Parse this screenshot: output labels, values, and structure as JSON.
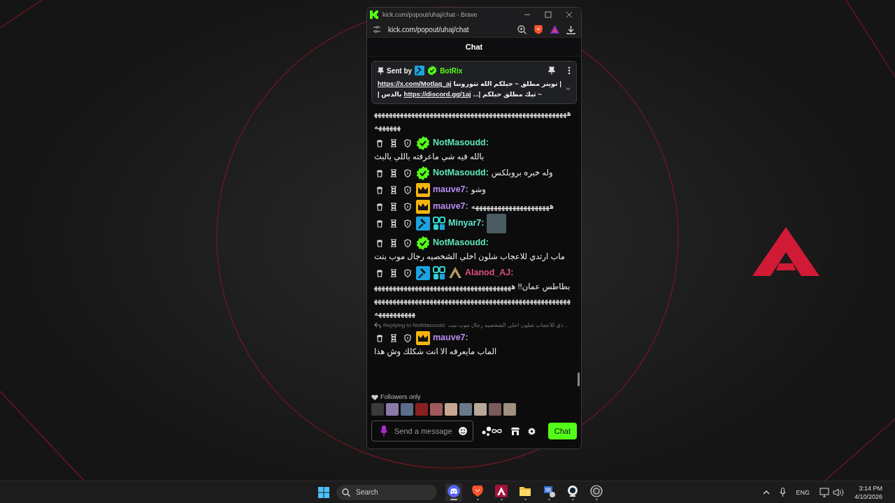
{
  "browser": {
    "title": "kick.com/popout/uhaj/chat - Brave",
    "url": "kick.com/popout/uhaj/chat"
  },
  "chat": {
    "title": "Chat",
    "pinned": {
      "sent_by": "Sent by",
      "sender": "BotRix",
      "sender_badges": [
        {
          "kind": "hammer"
        },
        {
          "kind": "verified"
        }
      ],
      "lines": [
        {
          "link": "https://x.com/Motlaq_aj",
          "text": "| تويتر مطلق ~ حيلكم الله تتوروننا"
        },
        {
          "prefix": "بالدس |",
          "link": "https://discord.gg/1aj",
          "text": "~ ثيك مطلق حيلكم |..."
        }
      ]
    },
    "messages": [
      {
        "kind": "continuation",
        "text": "هههههههههههههههههههههههههههههههههههههههههههههههههههههههههههه"
      },
      {
        "kind": "message",
        "badges": [
          {
            "kind": "verified"
          }
        ],
        "name": "NotMasoudd:",
        "color": "#5ee6b8",
        "text": "بالله فيه شي ماعرفته باللي بالبث"
      },
      {
        "kind": "message",
        "badges": [
          {
            "kind": "verified"
          }
        ],
        "name": "NotMasoudd:",
        "color": "#5ee6b8",
        "text": "وله خبره بروبلكس"
      },
      {
        "kind": "message",
        "badges": [
          {
            "kind": "crown"
          }
        ],
        "name": "mauve7:",
        "color": "#b98cf0",
        "text": "وشو"
      },
      {
        "kind": "message",
        "badges": [
          {
            "kind": "crown"
          }
        ],
        "name": "mauve7:",
        "color": "#b98cf0",
        "text": "هههههههههههههههههههههه"
      },
      {
        "kind": "emote",
        "badges": [
          {
            "kind": "hammer"
          },
          {
            "kind": "og"
          }
        ],
        "name": "Minyar7:",
        "color": "#5ee6c8"
      },
      {
        "kind": "message",
        "badges": [
          {
            "kind": "verified"
          }
        ],
        "name": "NotMasoudd:",
        "color": "#5ee6b8",
        "text": "ماب ارتدي للاعجاب شلون اخلي الشخصيه رجال موب بنت"
      },
      {
        "kind": "message",
        "badges": [
          {
            "kind": "hammer"
          },
          {
            "kind": "og"
          },
          {
            "kind": "logo"
          }
        ],
        "name": "Alanod_AJ:",
        "color": "#e0507c",
        "text": "بطاطس عمان!! هههههههههههههههههههههههههههههههههههههههههههههههههههههههههههههههههههههههههههههههههههههههههههههههههههههه"
      },
      {
        "kind": "reply",
        "label": "Replying to NotMasoudd:",
        "text": "…دي للاعجاب شلون اخلي الشخصيه رجال موب بنت"
      },
      {
        "kind": "message",
        "badges": [
          {
            "kind": "crown"
          }
        ],
        "name": "mauve7:",
        "color": "#b98cf0",
        "text": "الماب مايعرفه الا انت شكلك وش هذا"
      }
    ],
    "followers_only": "Followers only",
    "avatars": [
      {
        "kind": "photo"
      },
      {
        "kind": "photo"
      },
      {
        "kind": "photo"
      },
      {
        "kind": "photo"
      },
      {
        "kind": "photo"
      },
      {
        "kind": "photo"
      },
      {
        "kind": "photo"
      },
      {
        "kind": "photo"
      },
      {
        "kind": "photo"
      },
      {
        "kind": "photo"
      }
    ],
    "input": {
      "placeholder": "Send a message"
    },
    "send_button": "Chat"
  },
  "taskbar": {
    "search": "Search",
    "apps": [
      {
        "kind": "discord",
        "selected": true
      },
      {
        "kind": "brave",
        "selected": false
      },
      {
        "kind": "app",
        "selected": false
      },
      {
        "kind": "folder",
        "selected": false
      },
      {
        "kind": "remote",
        "selected": false
      },
      {
        "kind": "camera",
        "selected": false
      },
      {
        "kind": "obs",
        "selected": false
      }
    ],
    "language": "ENG",
    "time": "3:14 PM",
    "date": "4/10/2026"
  }
}
